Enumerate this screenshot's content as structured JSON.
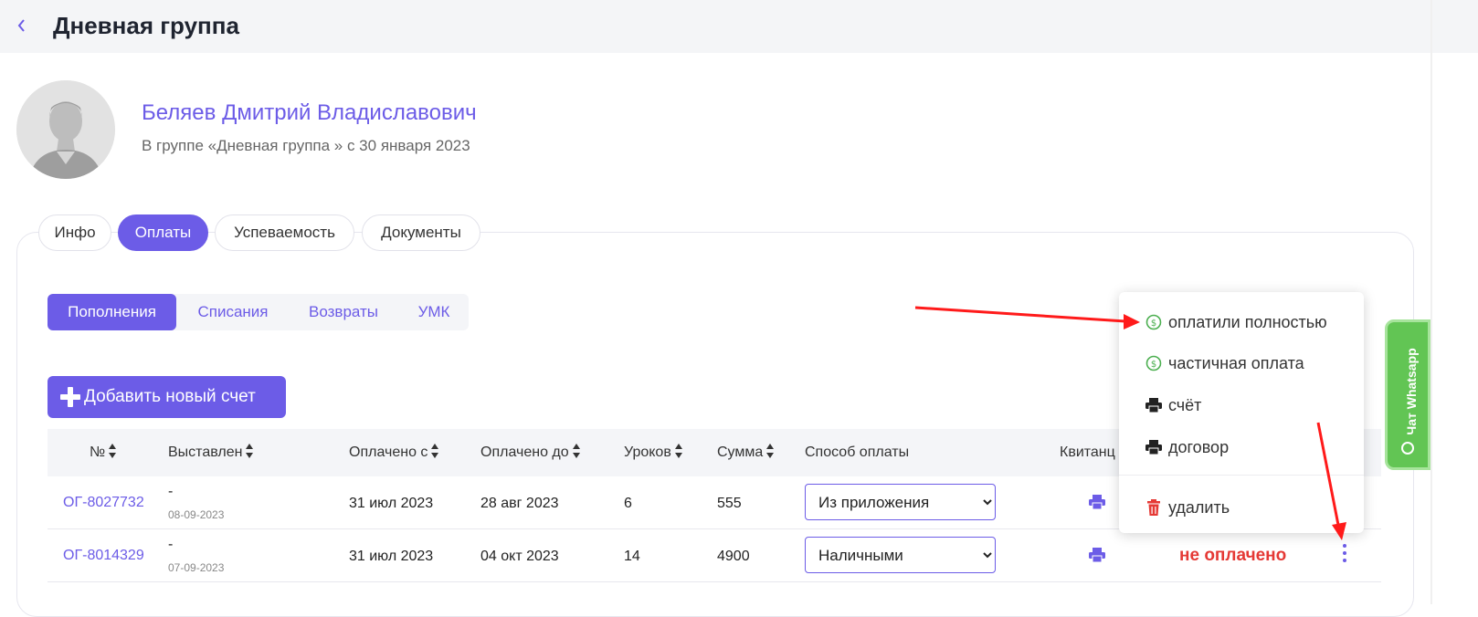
{
  "header": {
    "title": "Дневная группа",
    "back_icon": "chevron-left-icon"
  },
  "student": {
    "name": "Беляев Дмитрий Владиславович",
    "subtitle": "В группе «Дневная группа » с 30 января 2023"
  },
  "tabs": [
    {
      "label": "Инфо",
      "active": false
    },
    {
      "label": "Оплаты",
      "active": true
    },
    {
      "label": "Успеваемость",
      "active": false
    },
    {
      "label": "Документы",
      "active": false
    }
  ],
  "subtabs": [
    {
      "label": "Пополнения",
      "active": true
    },
    {
      "label": "Списания",
      "active": false
    },
    {
      "label": "Возвраты",
      "active": false
    },
    {
      "label": "УМК",
      "active": false
    }
  ],
  "add_button": {
    "label": "Добавить новый счет"
  },
  "table": {
    "columns": [
      "№",
      "Выставлен",
      "Оплачено с",
      "Оплачено до",
      "Уроков",
      "Сумма",
      "Способ оплаты",
      "Квитанц"
    ],
    "rows": [
      {
        "number": "ОГ-8027732",
        "issued_by": "-",
        "issued_date": "08-09-2023",
        "paid_from": "31 июл 2023",
        "paid_to": "28 авг 2023",
        "lessons": "6",
        "sum": "555",
        "method": "Из приложения",
        "status": ""
      },
      {
        "number": "ОГ-8014329",
        "issued_by": "-",
        "issued_date": "07-09-2023",
        "paid_from": "31 июл 2023",
        "paid_to": "04 окт 2023",
        "lessons": "14",
        "sum": "4900",
        "method": "Наличными",
        "status": "не оплачено"
      }
    ]
  },
  "dropdown": {
    "items": [
      {
        "label": "оплатили полностью",
        "icon": "dollar-circle-icon"
      },
      {
        "label": "частичная оплата",
        "icon": "dollar-circle-icon"
      },
      {
        "label": "счёт",
        "icon": "printer-icon"
      },
      {
        "label": "договор",
        "icon": "printer-icon"
      },
      {
        "label": "удалить",
        "icon": "trash-icon"
      }
    ]
  },
  "chat_widget": {
    "label": "Чат Whatsapp"
  },
  "colors": {
    "accent": "#6c5ce7",
    "danger": "#e53935",
    "success": "#4caf50",
    "whatsapp": "#62c554",
    "annotation": "#ff1a1a"
  }
}
